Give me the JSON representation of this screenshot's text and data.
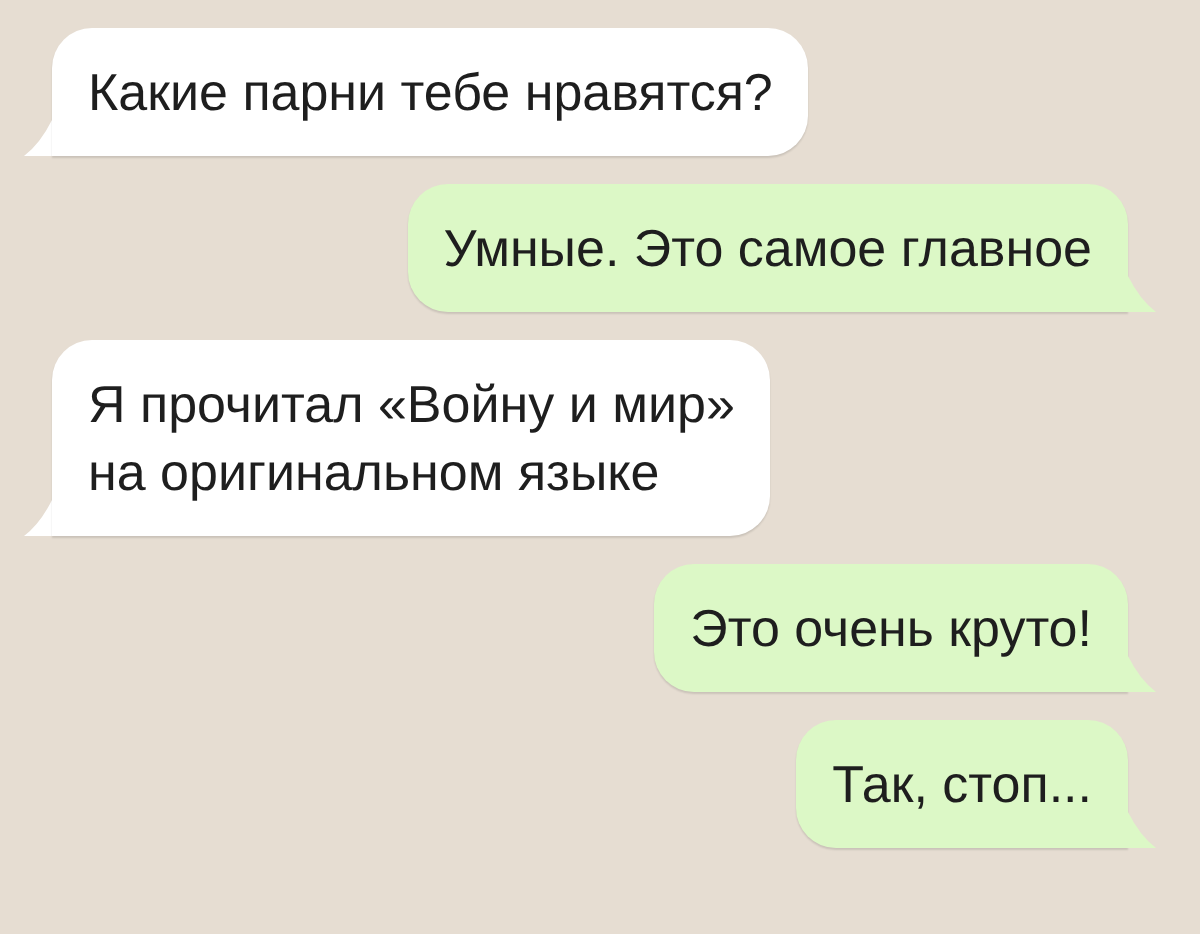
{
  "messages": [
    {
      "kind": "incoming",
      "text": "Какие парни тебе нравятся?"
    },
    {
      "kind": "outgoing",
      "text": "Умные. Это самое главное"
    },
    {
      "kind": "incoming",
      "text": "Я прочитал «Войну и мир»\nна оригинальном языке"
    },
    {
      "kind": "outgoing",
      "text": "Это очень круто!"
    },
    {
      "kind": "outgoing",
      "text": "Так, стоп..."
    }
  ]
}
